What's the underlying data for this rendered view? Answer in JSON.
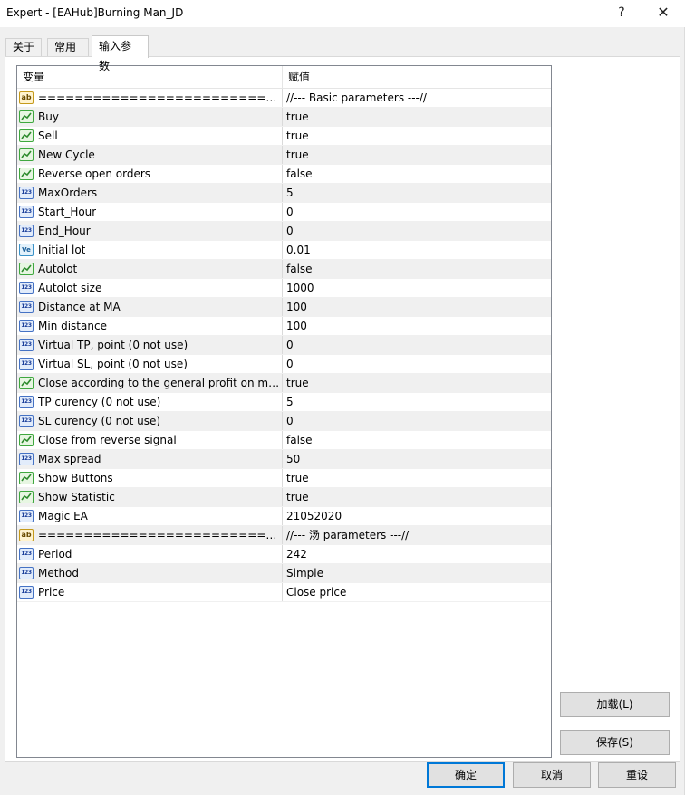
{
  "window": {
    "title": "Expert - [EAHub]Burning Man_JD",
    "help_label": "?",
    "close_label": "✕"
  },
  "tabs": [
    {
      "label": "关于"
    },
    {
      "label": "常用"
    },
    {
      "label": "输入参数"
    }
  ],
  "grid": {
    "col_variable": "变量",
    "col_value": "赋值",
    "rows": [
      {
        "name": "============================...",
        "value": "//--- Basic parameters ---//",
        "type": "ab"
      },
      {
        "name": "Buy",
        "value": "true",
        "type": "bool"
      },
      {
        "name": "Sell",
        "value": "true",
        "type": "bool"
      },
      {
        "name": "New Cycle",
        "value": "true",
        "type": "bool"
      },
      {
        "name": "Reverse open orders",
        "value": "false",
        "type": "bool"
      },
      {
        "name": "MaxOrders",
        "value": "5",
        "type": "123"
      },
      {
        "name": "Start_Hour",
        "value": "0",
        "type": "123"
      },
      {
        "name": "End_Hour",
        "value": "0",
        "type": "123"
      },
      {
        "name": "Initial lot",
        "value": "0.01",
        "type": "Ve"
      },
      {
        "name": "Autolot",
        "value": "false",
        "type": "bool"
      },
      {
        "name": "Autolot size",
        "value": "1000",
        "type": "123"
      },
      {
        "name": "Distance at MA",
        "value": "100",
        "type": "123"
      },
      {
        "name": "Min distance",
        "value": "100",
        "type": "123"
      },
      {
        "name": "Virtual TP, point (0 not use)",
        "value": "0",
        "type": "123"
      },
      {
        "name": "Virtual SL, point (0 not use)",
        "value": "0",
        "type": "123"
      },
      {
        "name": "Close according to the general profit on ma...",
        "value": "true",
        "type": "bool"
      },
      {
        "name": "TP curency (0 not use)",
        "value": "5",
        "type": "123"
      },
      {
        "name": "SL curency (0 not use)",
        "value": "0",
        "type": "123"
      },
      {
        "name": "Close from reverse signal",
        "value": "false",
        "type": "bool"
      },
      {
        "name": "Max spread",
        "value": "50",
        "type": "123"
      },
      {
        "name": "Show Buttons",
        "value": "true",
        "type": "bool"
      },
      {
        "name": "Show Statistic",
        "value": "true",
        "type": "bool"
      },
      {
        "name": "Magic EA",
        "value": "21052020",
        "type": "123"
      },
      {
        "name": "============================...",
        "value": "//--- 汤 parameters ---//",
        "type": "ab"
      },
      {
        "name": "Period",
        "value": "242",
        "type": "123"
      },
      {
        "name": "Method",
        "value": "Simple",
        "type": "123"
      },
      {
        "name": "Price",
        "value": "Close price",
        "type": "123"
      }
    ]
  },
  "buttons": {
    "load": "加载(L)",
    "save": "保存(S)",
    "ok": "确定",
    "cancel": "取消",
    "reset": "重设"
  }
}
